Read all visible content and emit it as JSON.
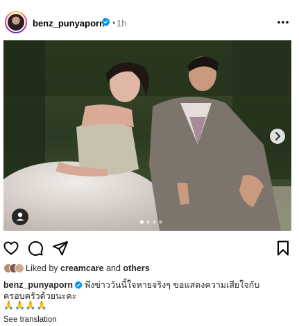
{
  "post": {
    "username": "benz_punyaporn",
    "dot": "•",
    "time": "1h"
  },
  "media": {
    "carousel_count": 4,
    "active_index": 0
  },
  "likes": {
    "prefix": "Liked by",
    "user": "creamcare",
    "middle": "and",
    "suffix": "others"
  },
  "caption": {
    "username": "benz_punyaporn",
    "text": "พึงข่าววันนี้ใจหายจริงๆ ขอแสดงความเสียใจกับครอบครัวด้วยนะคะ",
    "emoji": "🙏🙏🙏🙏"
  },
  "see_translation": "See translation",
  "colors": {
    "verified": "#0095f6",
    "muted": "#737373"
  }
}
